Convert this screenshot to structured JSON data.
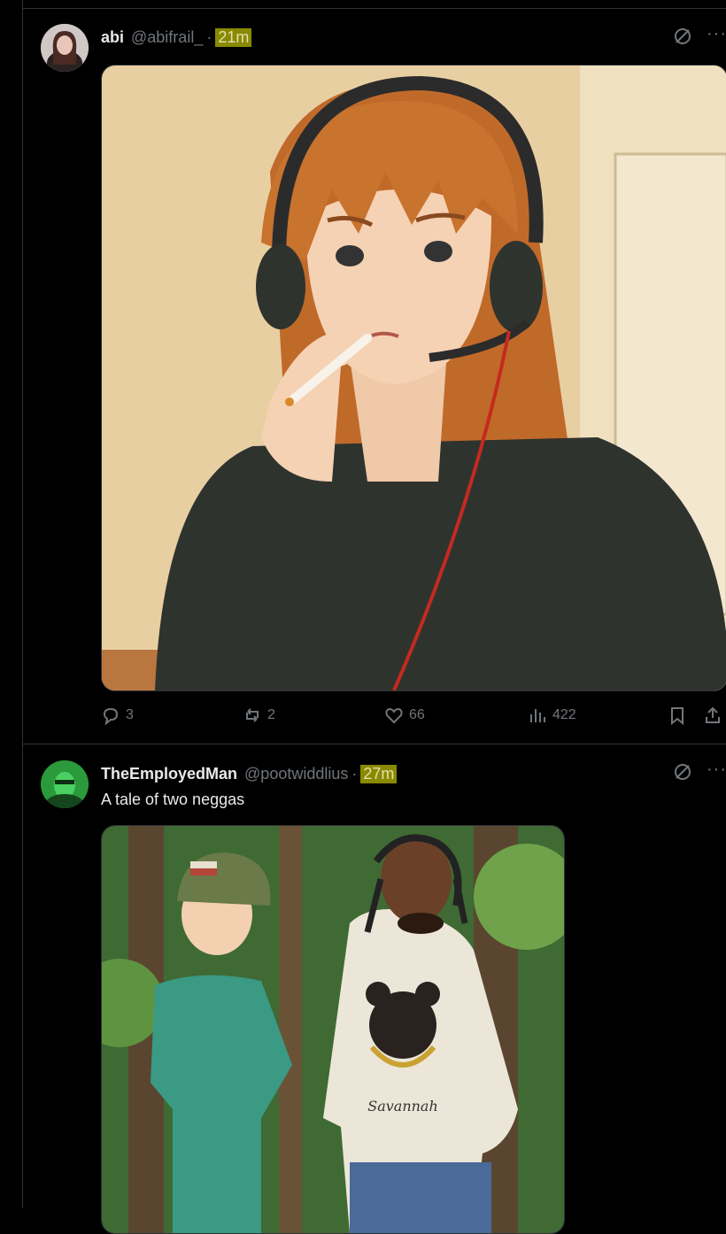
{
  "posts": [
    {
      "name": "abi",
      "handle": "@abifrail_",
      "time": "21m",
      "text": "",
      "actions": {
        "replies": "3",
        "reposts": "2",
        "likes": "66",
        "views": "422"
      }
    },
    {
      "name": "TheEmployedMan",
      "handle": "@pootwiddlius",
      "time": "27m",
      "text": "A tale of two neggas",
      "image_text": "Savannah"
    }
  ],
  "icons": {
    "reply": "reply-icon",
    "repost": "repost-icon",
    "like": "heart-icon",
    "views": "views-icon",
    "bookmark": "bookmark-icon",
    "share": "share-icon",
    "grok": "grok-icon",
    "more": "more-icon"
  },
  "colors": {
    "background": "#000000",
    "muted": "#71767b",
    "text": "#e7e9ea",
    "time_highlight": "#8a8a00",
    "border": "#2f3336"
  }
}
